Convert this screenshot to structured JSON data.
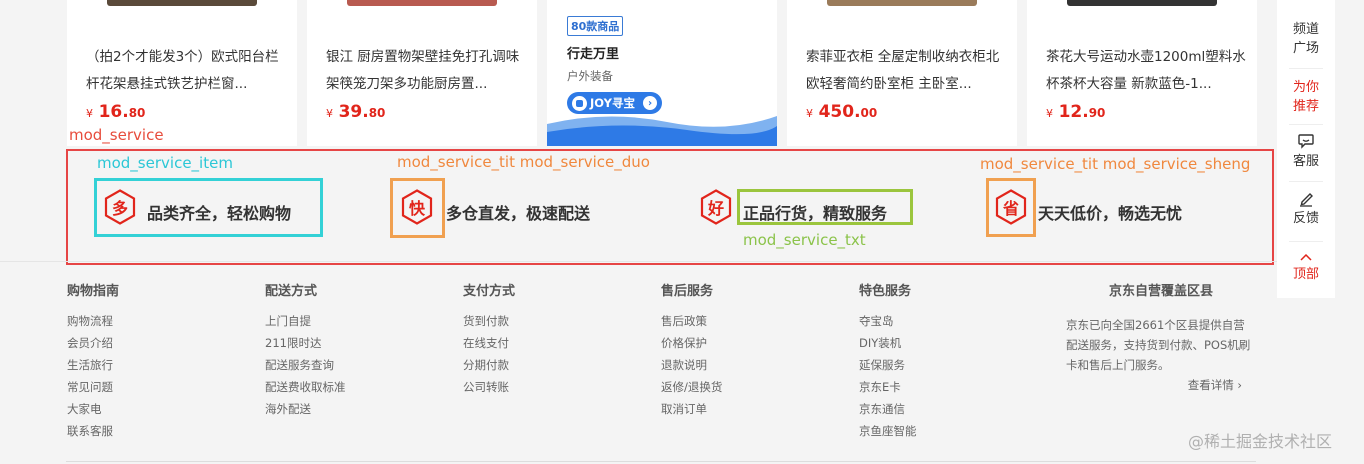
{
  "products": [
    {
      "title": "（拍2个才能发3个）欧式阳台栏杆花架悬挂式铁艺护栏窗...",
      "currency": "¥",
      "price_int": "16.",
      "price_dec": "80"
    },
    {
      "title": "银江 厨房置物架壁挂免打孔调味架筷笼刀架多功能厨房置...",
      "currency": "¥",
      "price_int": "39.",
      "price_dec": "80"
    },
    {
      "title": "索菲亚衣柜 全屋定制收纳衣柜北欧轻奢简约卧室柜 主卧室...",
      "currency": "¥",
      "price_int": "450.",
      "price_dec": "00"
    },
    {
      "title": "茶花大号运动水壶1200ml塑料水杯茶杯大容量 新款蓝色-1...",
      "currency": "¥",
      "price_int": "12.",
      "price_dec": "90"
    }
  ],
  "promo": {
    "tag": "80款商品",
    "title": "行走万里",
    "subtitle": "户外装备",
    "button": "JOY寻宝",
    "button_arrow": "›"
  },
  "sidebar": {
    "items": [
      {
        "line1": "频道",
        "line2": "广场"
      },
      {
        "line1": "为你",
        "line2": "推荐"
      },
      {
        "icon": "chat-icon",
        "label": "客服"
      },
      {
        "icon": "edit-icon",
        "label": "反馈"
      },
      {
        "icon": "chevron-up-icon",
        "label": "顶部"
      }
    ]
  },
  "annotations": {
    "mod_service": "mod_service",
    "mod_service_item": "mod_service_item",
    "tit_duo": "mod_service_tit mod_service_duo",
    "tit_sheng": "mod_service_tit mod_service_sheng",
    "txt": "mod_service_txt"
  },
  "services": [
    {
      "icon_char": "多",
      "text": "品类齐全，轻松购物"
    },
    {
      "icon_char": "快",
      "text": "多仓直发，极速配送"
    },
    {
      "icon_char": "好",
      "text": "正品行货，精致服务"
    },
    {
      "icon_char": "省",
      "text": "天天低价，畅选无忧"
    }
  ],
  "footer": {
    "columns": [
      {
        "title": "购物指南",
        "items": [
          "购物流程",
          "会员介绍",
          "生活旅行",
          "常见问题",
          "大家电",
          "联系客服"
        ]
      },
      {
        "title": "配送方式",
        "items": [
          "上门自提",
          "211限时达",
          "配送服务查询",
          "配送费收取标准",
          "海外配送"
        ]
      },
      {
        "title": "支付方式",
        "items": [
          "货到付款",
          "在线支付",
          "分期付款",
          "公司转账"
        ]
      },
      {
        "title": "售后服务",
        "items": [
          "售后政策",
          "价格保护",
          "退款说明",
          "返修/退换货",
          "取消订单"
        ]
      },
      {
        "title": "特色服务",
        "items": [
          "夺宝岛",
          "DIY装机",
          "延保服务",
          "京东E卡",
          "京东通信",
          "京鱼座智能"
        ]
      }
    ],
    "coverage": {
      "title": "京东自营覆盖区县",
      "text": "京东已向全国2661个区县提供自营配送服务，支持货到付款、POS机刷卡和售后上门服务。",
      "more": "查看详情 ›"
    }
  },
  "watermark": "@稀土掘金技术社区",
  "colors": {
    "accent_red": "#e1251b",
    "annot_red": "#e64545",
    "annot_cyan": "#33d1d6",
    "annot_orange": "#f0a050",
    "annot_green": "#9bc53d",
    "promo_blue": "#2e7ae6"
  }
}
